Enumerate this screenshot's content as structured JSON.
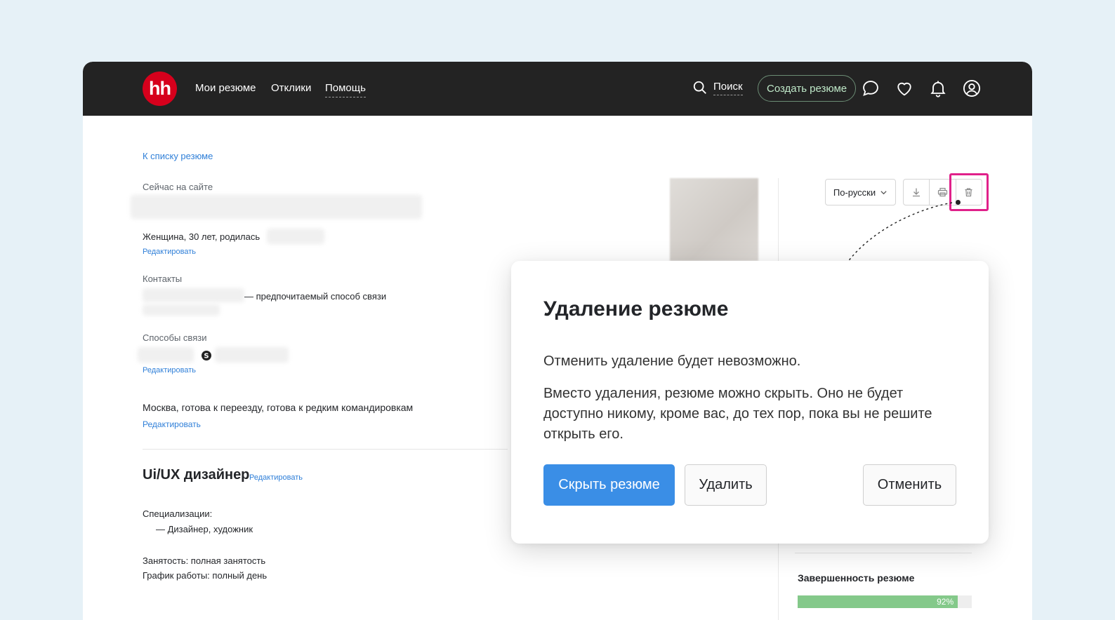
{
  "header": {
    "logo": "hh",
    "nav": [
      "Мои резюме",
      "Отклики",
      "Помощь"
    ],
    "search_label": "Поиск",
    "create_label": "Создать резюме"
  },
  "resume": {
    "back_link": "К списку резюме",
    "status": "Сейчас на сайте",
    "personal": "Женщина, 30 лет, родилась",
    "edit": "Редактировать",
    "contacts_label": "Контакты",
    "preferred": "— предпочитаемый способ связи",
    "ways_label": "Способы связи",
    "location": "Москва, готова к переезду, готова к редким командировкам",
    "position": "Ui/UX дизайнер",
    "spec_label": "Специализации:",
    "spec_value": "— Дизайнер, художник",
    "employment": "Занятость: полная занятость",
    "schedule": "График работы: полный день"
  },
  "toolbar": {
    "language": "По-русски"
  },
  "completeness": {
    "title": "Завершенность резюме",
    "percent_label": "92%",
    "value": 0.92
  },
  "modal": {
    "title": "Удаление резюме",
    "p1": "Отменить удаление будет невозможно.",
    "p2": "Вместо удаления, резюме можно скрыть. Оно не будет доступно никому, кроме вас, до тех пор, пока вы не решите открыть его.",
    "hide_button": "Скрыть резюме",
    "delete_button": "Удалить",
    "cancel_button": "Отменить"
  },
  "colors": {
    "accent": "#3a8ee6",
    "brand": "#d6001c",
    "highlight": "#e0218a",
    "link": "#2f7fd8"
  }
}
